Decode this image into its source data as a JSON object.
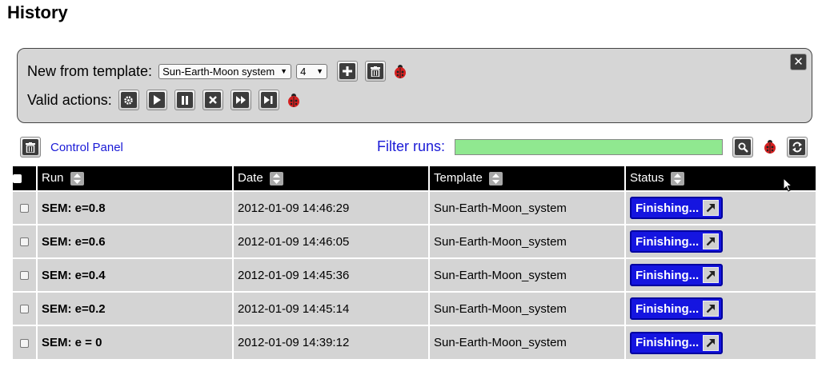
{
  "page": {
    "title": "History"
  },
  "panel": {
    "new_from_template_label": "New from template:",
    "template_select": {
      "value": "Sun-Earth-Moon system"
    },
    "count_select": {
      "value": "4"
    },
    "valid_actions_label": "Valid actions:",
    "close_symbol": "✕"
  },
  "toolbar": {
    "control_panel_label": "Control Panel",
    "filter_label": "Filter runs:",
    "filter_value": ""
  },
  "table": {
    "columns": [
      "Run",
      "Date",
      "Template",
      "Status"
    ],
    "rows": [
      {
        "run": "SEM: e=0.8",
        "date": "2012-01-09 14:46:29",
        "template": "Sun-Earth-Moon_system",
        "status": "Finishing..."
      },
      {
        "run": "SEM: e=0.6",
        "date": "2012-01-09 14:46:05",
        "template": "Sun-Earth-Moon_system",
        "status": "Finishing..."
      },
      {
        "run": "SEM: e=0.4",
        "date": "2012-01-09 14:45:36",
        "template": "Sun-Earth-Moon_system",
        "status": "Finishing..."
      },
      {
        "run": "SEM: e=0.2",
        "date": "2012-01-09 14:45:14",
        "template": "Sun-Earth-Moon_system",
        "status": "Finishing..."
      },
      {
        "run": "SEM: e = 0",
        "date": "2012-01-09 14:39:12",
        "template": "Sun-Earth-Moon_system",
        "status": "Finishing..."
      }
    ]
  },
  "icons": {
    "add": "plus-icon",
    "delete": "trash-icon",
    "debug": "ladybug-icon",
    "configure": "gear-icon",
    "play": "play-icon",
    "pause": "pause-icon",
    "stop": "stop-icon",
    "fast_forward": "fast-forward-icon",
    "skip": "skip-icon",
    "search": "search-icon",
    "refresh": "refresh-icon",
    "sort": "sort-icon",
    "external": "external-link-icon"
  },
  "colors": {
    "status_button": "#1515e0",
    "filter_input": "#90e890",
    "link": "#1a1ad6",
    "header_bg": "#000000",
    "row_bg": "#d4d4d4"
  }
}
